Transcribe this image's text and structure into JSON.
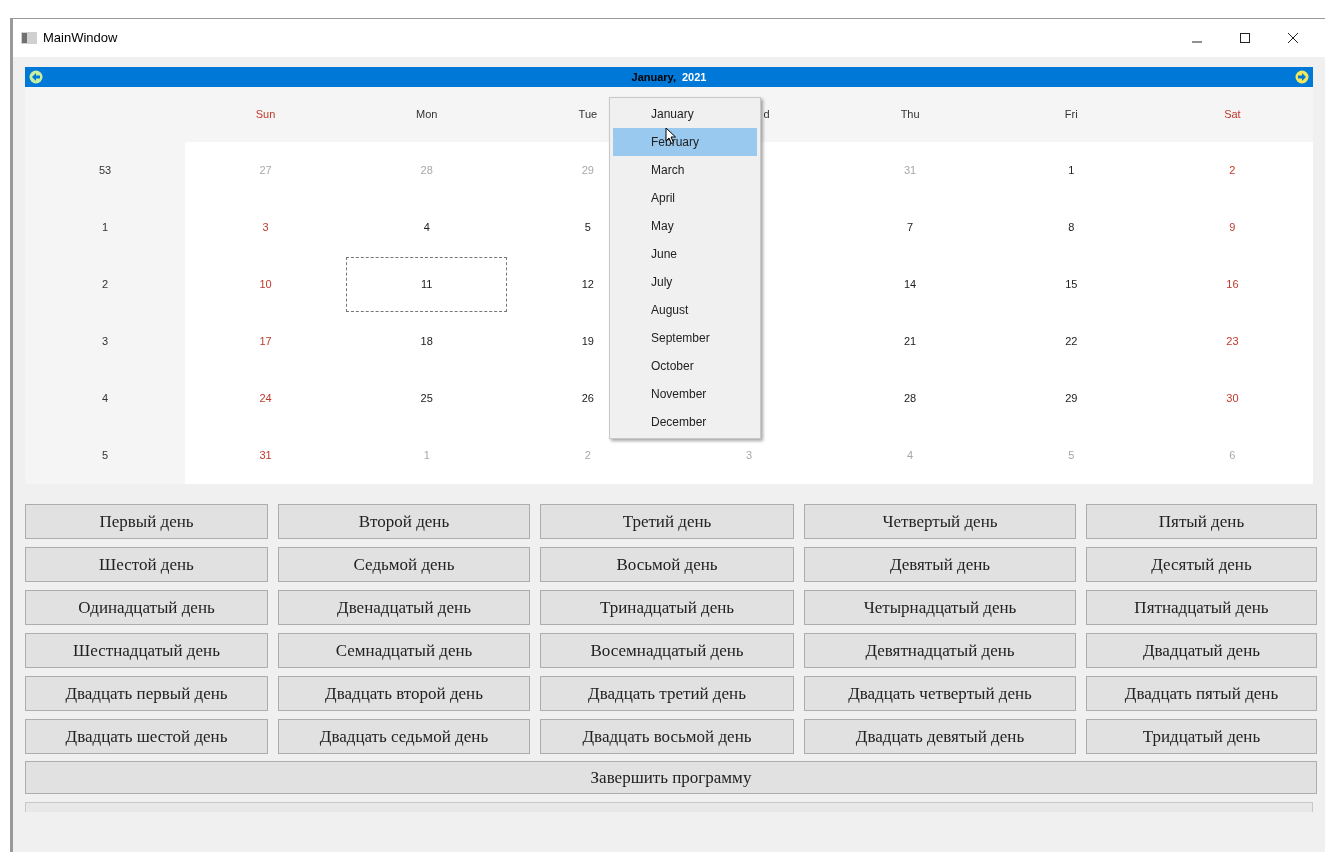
{
  "window": {
    "title": "MainWindow"
  },
  "calendar": {
    "month": "January,",
    "year": "2021",
    "headers": [
      {
        "text": "Sun",
        "weekend": true
      },
      {
        "text": "Mon",
        "weekend": false
      },
      {
        "text": "Tue",
        "weekend": false
      },
      {
        "text": "d",
        "weekend": false
      },
      {
        "text": "Thu",
        "weekend": false
      },
      {
        "text": "Fri",
        "weekend": false
      },
      {
        "text": "Sat",
        "weekend": true
      }
    ],
    "weeks": [
      {
        "number": "53",
        "cells": [
          {
            "kind": "day",
            "text": "27",
            "muted": true,
            "selected": false
          },
          {
            "kind": "day",
            "text": "28",
            "muted": true,
            "selected": false
          },
          {
            "kind": "day",
            "text": "29",
            "muted": true,
            "selected": false
          },
          {
            "kind": "covered"
          },
          {
            "kind": "day",
            "text": "31",
            "muted": true,
            "selected": false
          },
          {
            "kind": "day",
            "text": "1",
            "muted": false,
            "selected": false
          },
          {
            "kind": "day",
            "text": "2",
            "muted": false,
            "selected": false
          }
        ]
      },
      {
        "number": "1",
        "cells": [
          {
            "kind": "day",
            "text": "3",
            "muted": false,
            "selected": false
          },
          {
            "kind": "day",
            "text": "4",
            "muted": false,
            "selected": false
          },
          {
            "kind": "day",
            "text": "5",
            "muted": false,
            "selected": false
          },
          {
            "kind": "covered"
          },
          {
            "kind": "day",
            "text": "7",
            "muted": false,
            "selected": false
          },
          {
            "kind": "day",
            "text": "8",
            "muted": false,
            "selected": false
          },
          {
            "kind": "day",
            "text": "9",
            "muted": false,
            "selected": false
          }
        ]
      },
      {
        "number": "2",
        "cells": [
          {
            "kind": "day",
            "text": "10",
            "muted": false,
            "selected": false
          },
          {
            "kind": "day",
            "text": "11",
            "muted": false,
            "selected": true
          },
          {
            "kind": "day",
            "text": "12",
            "muted": false,
            "selected": false
          },
          {
            "kind": "covered"
          },
          {
            "kind": "day",
            "text": "14",
            "muted": false,
            "selected": false
          },
          {
            "kind": "day",
            "text": "15",
            "muted": false,
            "selected": false
          },
          {
            "kind": "day",
            "text": "16",
            "muted": false,
            "selected": false
          }
        ]
      },
      {
        "number": "3",
        "cells": [
          {
            "kind": "day",
            "text": "17",
            "muted": false,
            "selected": false
          },
          {
            "kind": "day",
            "text": "18",
            "muted": false,
            "selected": false
          },
          {
            "kind": "day",
            "text": "19",
            "muted": false,
            "selected": false
          },
          {
            "kind": "covered"
          },
          {
            "kind": "day",
            "text": "21",
            "muted": false,
            "selected": false
          },
          {
            "kind": "day",
            "text": "22",
            "muted": false,
            "selected": false
          },
          {
            "kind": "day",
            "text": "23",
            "muted": false,
            "selected": false
          }
        ]
      },
      {
        "number": "4",
        "cells": [
          {
            "kind": "day",
            "text": "24",
            "muted": false,
            "selected": false
          },
          {
            "kind": "day",
            "text": "25",
            "muted": false,
            "selected": false
          },
          {
            "kind": "day",
            "text": "26",
            "muted": false,
            "selected": false
          },
          {
            "kind": "covered"
          },
          {
            "kind": "day",
            "text": "28",
            "muted": false,
            "selected": false
          },
          {
            "kind": "day",
            "text": "29",
            "muted": false,
            "selected": false
          },
          {
            "kind": "day",
            "text": "30",
            "muted": false,
            "selected": false
          }
        ]
      },
      {
        "number": "5",
        "cells": [
          {
            "kind": "day",
            "text": "31",
            "muted": false,
            "selected": false
          },
          {
            "kind": "day",
            "text": "1",
            "muted": true,
            "selected": false
          },
          {
            "kind": "day",
            "text": "2",
            "muted": true,
            "selected": false
          },
          {
            "kind": "day",
            "text": "3",
            "muted": true,
            "selected": false
          },
          {
            "kind": "day",
            "text": "4",
            "muted": true,
            "selected": false
          },
          {
            "kind": "day",
            "text": "5",
            "muted": true,
            "selected": false
          },
          {
            "kind": "day",
            "text": "6",
            "muted": true,
            "selected": false
          }
        ]
      }
    ],
    "month_menu": [
      {
        "label": "January",
        "selected": false
      },
      {
        "label": "February",
        "selected": true
      },
      {
        "label": "March",
        "selected": false
      },
      {
        "label": "April",
        "selected": false
      },
      {
        "label": "May",
        "selected": false
      },
      {
        "label": "June",
        "selected": false
      },
      {
        "label": "July",
        "selected": false
      },
      {
        "label": "August",
        "selected": false
      },
      {
        "label": "September",
        "selected": false
      },
      {
        "label": "October",
        "selected": false
      },
      {
        "label": "November",
        "selected": false
      },
      {
        "label": "December",
        "selected": false
      }
    ]
  },
  "day_buttons": [
    "Первый день",
    "Второй день",
    "Третий день",
    "Четвертый день",
    "Пятый день",
    "Шестой день",
    "Седьмой день",
    "Восьмой день",
    "Девятый день",
    "Десятый день",
    "Одинадцатый день",
    "Двенадцатый день",
    "Тринадцатый день",
    "Четырнадцатый день",
    "Пятнадцатый день",
    "Шестнадцатый день",
    "Семнадцатый день",
    "Восемнадцатый день",
    "Девятнадцатый день",
    "Двадцатый день",
    "Двадцать первый день",
    "Двадцать второй день",
    "Двадцать третий день",
    "Двадцать четвертый день",
    "Двадцать пятый день",
    "Двадцать шестой день",
    "Двадцать седьмой день",
    "Двадцать восьмой день",
    "Двадцать девятый день",
    "Тридцатый день"
  ],
  "exit_button": "Завершить программу"
}
